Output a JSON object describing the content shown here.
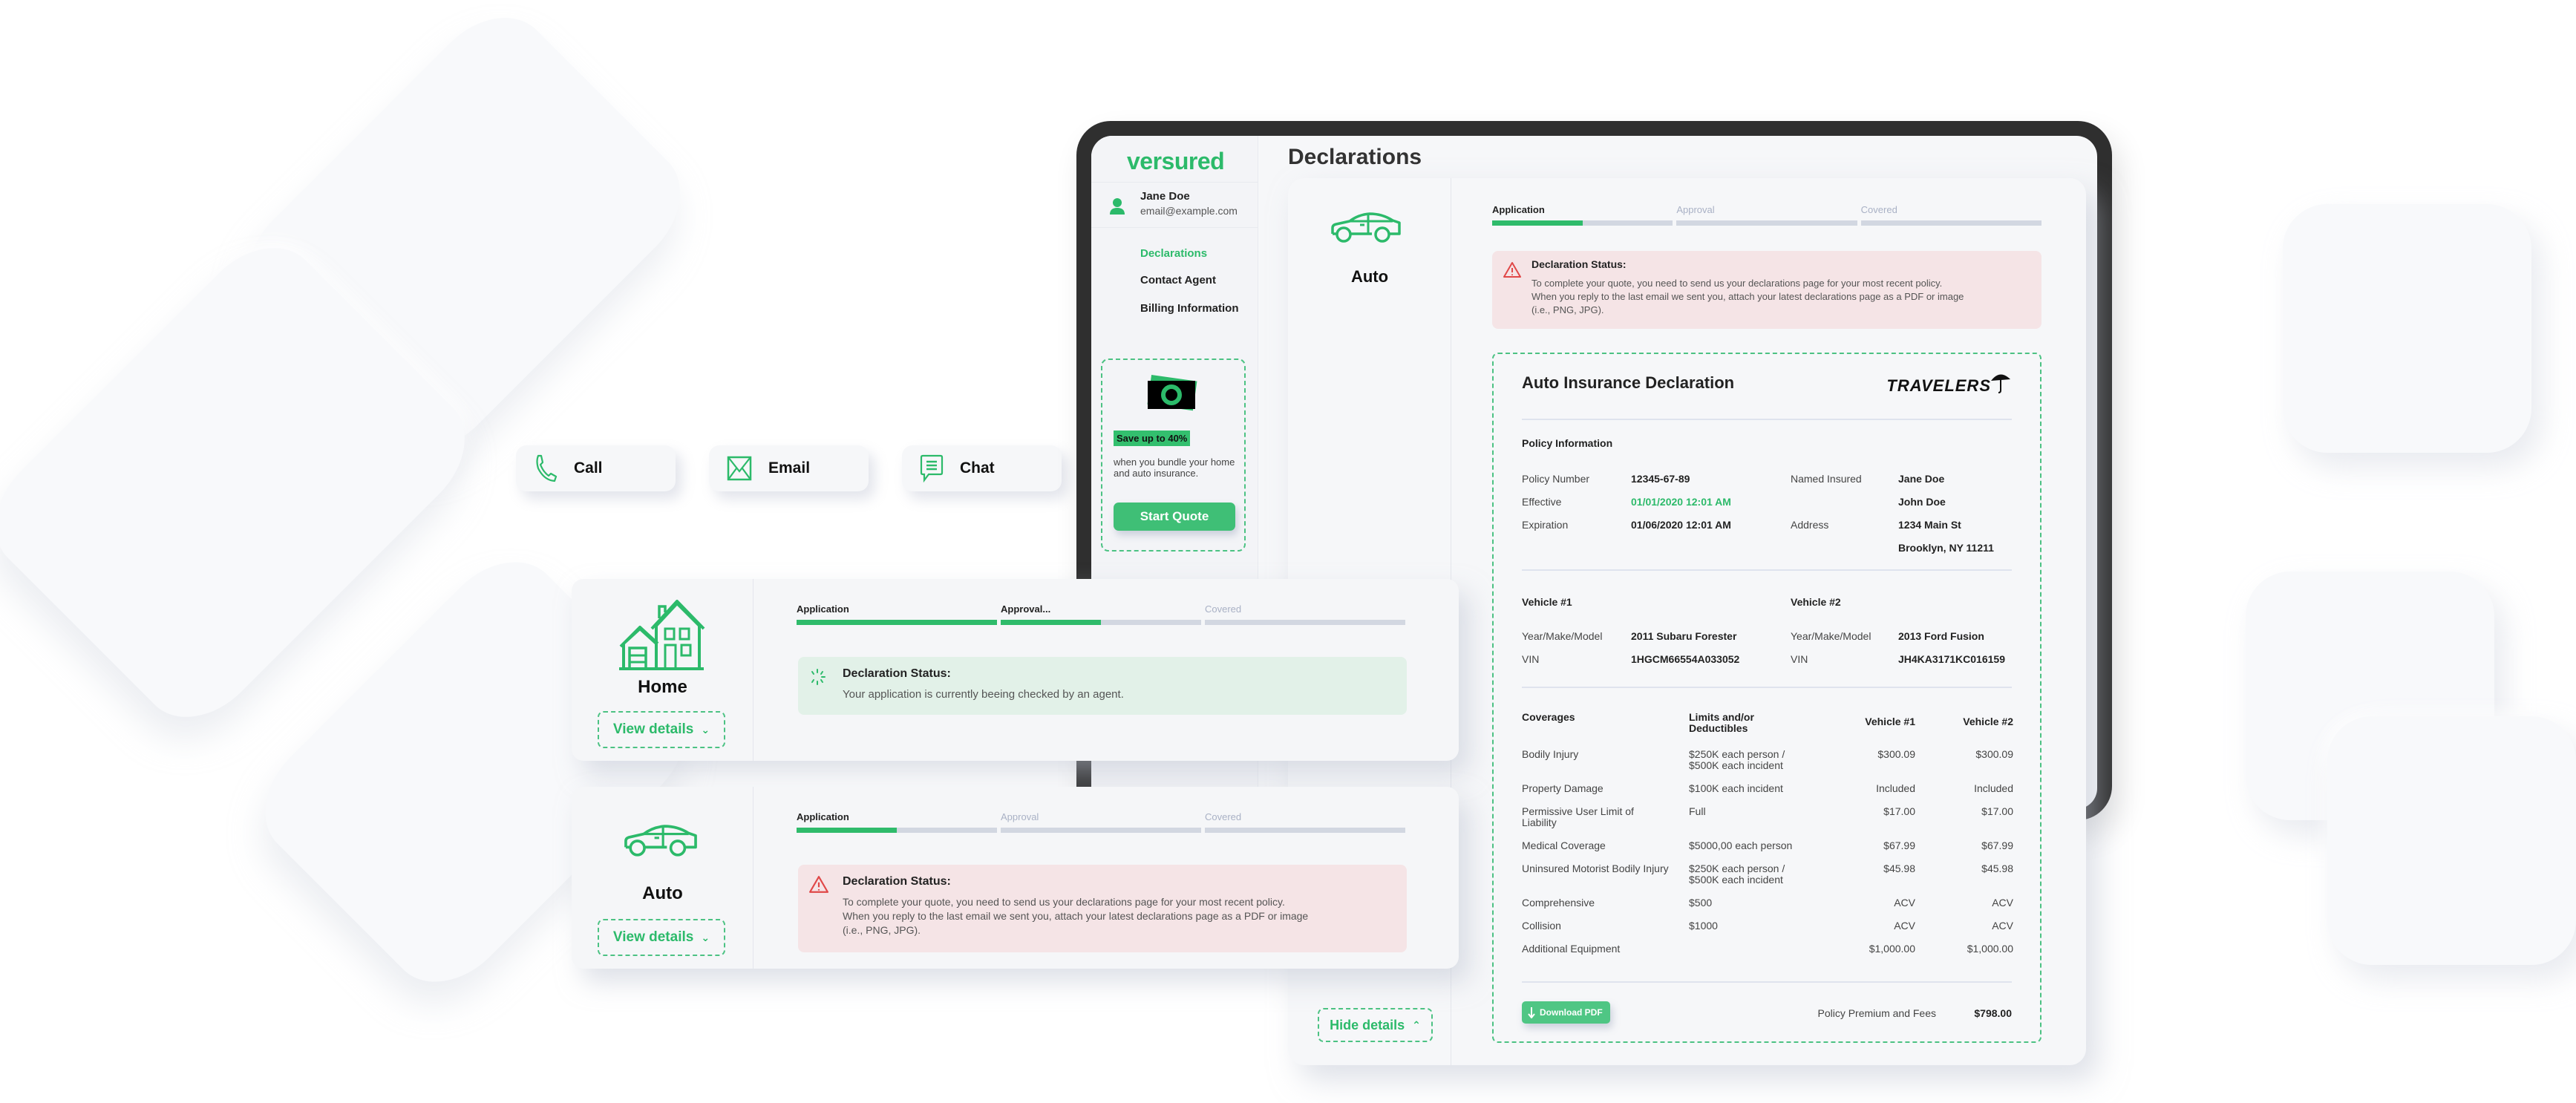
{
  "contact": {
    "call": {
      "label": "Call",
      "icon": "phone-icon"
    },
    "email": {
      "label": "Email",
      "icon": "envelope-icon"
    },
    "chat": {
      "label": "Chat",
      "icon": "chat-bubble-icon"
    }
  },
  "app": {
    "logo": "versured",
    "page_title": "Declarations",
    "brand_color": "#2cba6a",
    "user": {
      "name": "Jane Doe",
      "email": "email@example.com"
    },
    "nav": [
      {
        "label": "Declarations",
        "active": true
      },
      {
        "label": "Contact Agent",
        "active": false
      },
      {
        "label": "Billing Information",
        "active": false
      }
    ],
    "promo": {
      "badge": "Save up to 40%",
      "text": "when you bundle your home and auto insurance.",
      "button": "Start Quote"
    }
  },
  "detail": {
    "title": "Auto",
    "hide_button": "Hide details",
    "steps": [
      {
        "label": "Application",
        "progress": 0.5,
        "active": true
      },
      {
        "label": "Approval",
        "progress": 0,
        "active": false
      },
      {
        "label": "Covered",
        "progress": 0,
        "active": false
      }
    ],
    "status": {
      "title": "Declaration Status:",
      "line1": "To complete your quote, you need to send us your declarations page for your most recent policy.",
      "line2": "When you reply to the last email we sent you, attach your latest declarations page as a PDF or image",
      "line3": "(i.e., PNG, JPG)."
    },
    "declaration": {
      "title": "Auto Insurance Declaration",
      "carrier": "TRAVELERS",
      "policy_section": "Policy Information",
      "policy_number_label": "Policy Number",
      "policy_number": "12345-67-89",
      "effective_label": "Effective",
      "effective": "01/01/2020 12:01 AM",
      "expiration_label": "Expiration",
      "expiration": "01/06/2020 12:01 AM",
      "named_insured_label": "Named Insured",
      "named_insured_1": "Jane Doe",
      "named_insured_2": "John Doe",
      "address_label": "Address",
      "address_1": "1234 Main St",
      "address_2": "Brooklyn, NY 11211",
      "vehicle1": {
        "title": "Vehicle #1",
        "ymm_label": "Year/Make/Model",
        "ymm": "2011 Subaru Forester",
        "vin_label": "VIN",
        "vin": "1HGCM66554A033052"
      },
      "vehicle2": {
        "title": "Vehicle #2",
        "ymm_label": "Year/Make/Model",
        "ymm": "2013 Ford Fusion",
        "vin_label": "VIN",
        "vin": "JH4KA3171KC016159"
      },
      "coverage_headers": [
        "Coverages",
        "Limits and/or Deductibles",
        "Vehicle #1",
        "Vehicle #2"
      ],
      "coverages": [
        {
          "name": "Bodily Injury",
          "limit": "$250K each person / $500K each incident",
          "v1": "$300.09",
          "v2": "$300.09"
        },
        {
          "name": "Property Damage",
          "limit": "$100K each incident",
          "v1": "Included",
          "v2": "Included"
        },
        {
          "name": "Permissive User Limit of Liability",
          "limit": "Full",
          "v1": "$17.00",
          "v2": "$17.00"
        },
        {
          "name": "Medical Coverage",
          "limit": "$5000,00 each person",
          "v1": "$67.99",
          "v2": "$67.99"
        },
        {
          "name": "Uninsured Motorist Bodily Injury",
          "limit": "$250K each person / $500K each incident",
          "v1": "$45.98",
          "v2": "$45.98"
        },
        {
          "name": "Comprehensive",
          "limit": "$500",
          "v1": "ACV",
          "v2": "ACV"
        },
        {
          "name": "Collision",
          "limit": "$1000",
          "v1": "ACV",
          "v2": "ACV"
        },
        {
          "name": "Additional Equipment",
          "limit": "",
          "v1": "$1,000.00",
          "v2": "$1,000.00"
        }
      ],
      "download_button": "Download PDF",
      "premium_label": "Policy Premium and Fees",
      "premium_value": "$798.00"
    }
  },
  "home_card": {
    "title": "Home",
    "view_button": "View details",
    "steps": [
      {
        "label": "Application",
        "progress": 1,
        "active": true
      },
      {
        "label": "Approval...",
        "progress": 0.5,
        "active": true
      },
      {
        "label": "Covered",
        "progress": 0,
        "active": false
      }
    ],
    "status_title": "Declaration Status:",
    "status_body": "Your application is currently beeing checked by an agent."
  },
  "auto_card": {
    "title": "Auto",
    "view_button": "View details",
    "steps": [
      {
        "label": "Application",
        "progress": 0.5,
        "active": true
      },
      {
        "label": "Approval",
        "progress": 0,
        "active": false
      },
      {
        "label": "Covered",
        "progress": 0,
        "active": false
      }
    ],
    "status_title": "Declaration Status:",
    "status_line1": "To complete your quote, you need to send us your declarations page for your most recent policy.",
    "status_line2": "When you reply to the last email we sent you, attach your latest declarations page as a PDF or image",
    "status_line3": "(i.e., PNG, JPG)."
  }
}
